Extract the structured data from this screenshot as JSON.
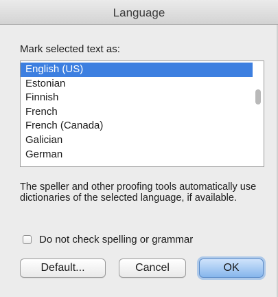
{
  "window": {
    "title": "Language"
  },
  "prompt": "Mark selected text as:",
  "languages": {
    "items": [
      "English (US)",
      "Estonian",
      "Finnish",
      "French",
      "French (Canada)",
      "Galician",
      "German"
    ],
    "selected_index": 0
  },
  "description": "The speller and other proofing tools automatically use dictionaries of the selected language, if available.",
  "no_check": {
    "label": "Do not check spelling or grammar",
    "checked": false
  },
  "buttons": {
    "default": "Default...",
    "cancel": "Cancel",
    "ok": "OK"
  },
  "colors": {
    "selection": "#3d7fe0",
    "ok_button": "#86b6ec",
    "background": "#ececec"
  }
}
